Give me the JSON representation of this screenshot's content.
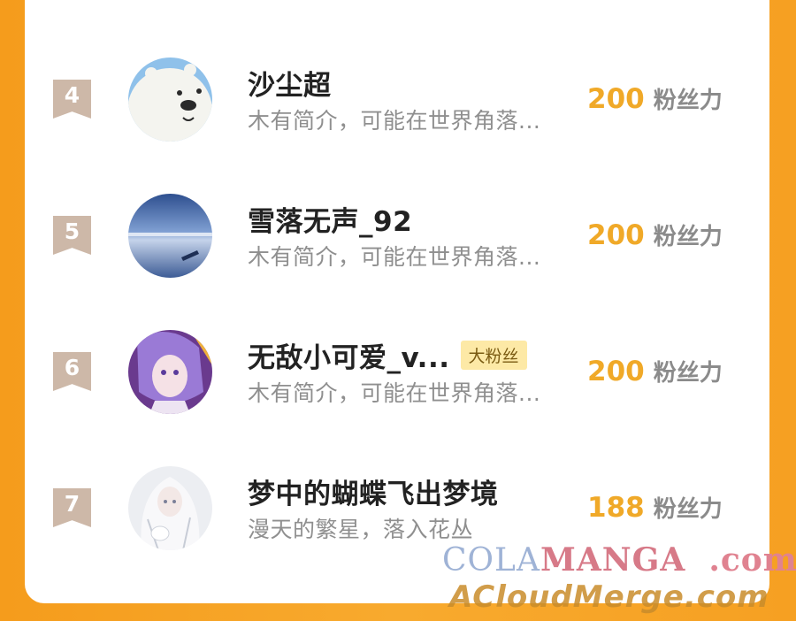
{
  "ranking": {
    "items": [
      {
        "rank": "4",
        "name": "沙尘超",
        "badge": "",
        "bio": "木有简介，可能在世界角落...",
        "score": "200",
        "unit": "粉丝力",
        "avatar_icon": "polar-bear-avatar"
      },
      {
        "rank": "5",
        "name": "雪落无声_92",
        "badge": "",
        "bio": "木有简介，可能在世界角落...",
        "score": "200",
        "unit": "粉丝力",
        "avatar_icon": "lake-landscape-avatar"
      },
      {
        "rank": "6",
        "name": "无敌小可爱_v...",
        "badge": "大粉丝",
        "bio": "木有简介，可能在世界角落...",
        "score": "200",
        "unit": "粉丝力",
        "avatar_icon": "anime-girl-purple-avatar"
      },
      {
        "rank": "7",
        "name": "梦中的蝴蝶飞出梦境",
        "badge": "",
        "bio": "漫天的繁星，落入花丛",
        "score": "188",
        "unit": "粉丝力",
        "avatar_icon": "white-hair-girl-avatar"
      }
    ]
  },
  "watermark": {
    "line1_a": "COLA",
    "line1_b": "MANGA",
    "line1_c": ".com",
    "line2": "ACloudMerge.com"
  },
  "colors": {
    "background": "#f7a11f",
    "score": "#f0a928",
    "rank_flag": "#cdb8a8",
    "badge_bg": "#fde9a6"
  }
}
